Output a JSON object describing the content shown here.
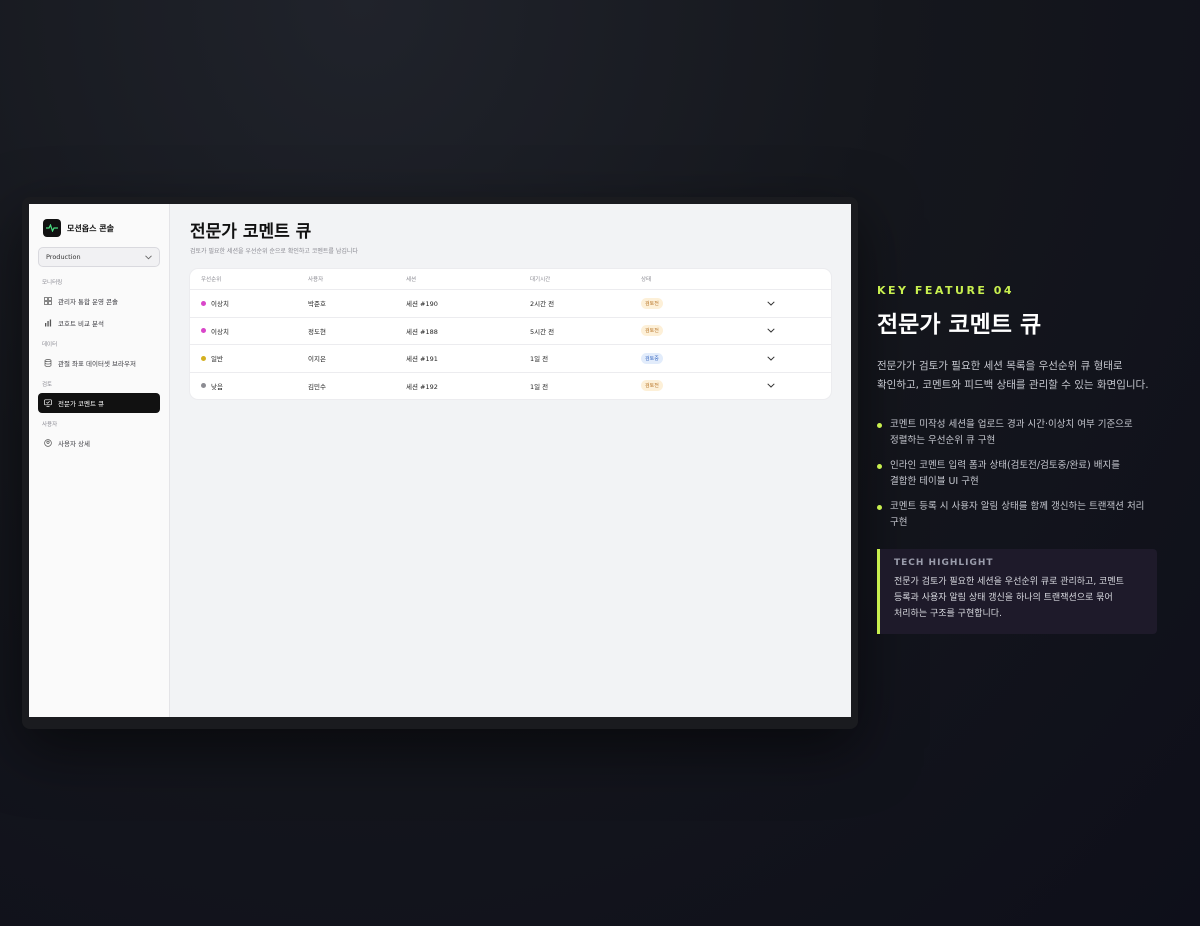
{
  "console": {
    "brand_name": "모션옵스 콘솔",
    "env_select": "Production",
    "sidebar": {
      "sections": [
        {
          "label": "모니터링",
          "items": [
            {
              "label": "관리자 통합 운영 콘솔",
              "icon": "grid-icon"
            },
            {
              "label": "코호트 비교 분석",
              "icon": "bar-chart-icon"
            }
          ]
        },
        {
          "label": "데이터",
          "items": [
            {
              "label": "관절 좌표 데이터셋 브라우저",
              "icon": "database-icon"
            }
          ]
        },
        {
          "label": "검토",
          "items": [
            {
              "label": "전문가 코멘트 큐",
              "icon": "comment-icon",
              "active": true
            }
          ]
        },
        {
          "label": "사용자",
          "items": [
            {
              "label": "사용자 상세",
              "icon": "user-circle-icon"
            }
          ]
        }
      ]
    },
    "page_title": "전문가 코멘트 큐",
    "page_subtitle": "검토가 필요한 세션을 우선순위 순으로 확인하고 코멘트를 남깁니다",
    "table": {
      "headers": [
        "우선순위",
        "사용자",
        "세션",
        "대기시간",
        "상태"
      ],
      "rows": [
        {
          "priority": "이상치",
          "dot_color": "#d946c9",
          "user": "박준호",
          "session": "세션 #190",
          "wait": "2시간 전",
          "status": "검토전",
          "status_kind": "warn"
        },
        {
          "priority": "이상치",
          "dot_color": "#d946c9",
          "user": "정도현",
          "session": "세션 #188",
          "wait": "5시간 전",
          "status": "검토전",
          "status_kind": "warn"
        },
        {
          "priority": "일반",
          "dot_color": "#d4b020",
          "user": "이지은",
          "session": "세션 #191",
          "wait": "1일 전",
          "status": "검토중",
          "status_kind": "info"
        },
        {
          "priority": "낮음",
          "dot_color": "#8c8c93",
          "user": "김민수",
          "session": "세션 #192",
          "wait": "1일 전",
          "status": "검토전",
          "status_kind": "warn"
        }
      ]
    }
  },
  "panel": {
    "kicker": "KEY FEATURE 04",
    "title": "전문가 코멘트 큐",
    "desc_lines": [
      "전문가가 검토가 필요한 세션 목록을 우선순위 큐 형태로",
      "확인하고, 코멘트와 피드백 상태를 관리할 수 있는 화면입니다."
    ],
    "bullets": [
      {
        "lines": [
          "코멘트 미작성 세션을 업로드 경과 시간·이상치 여부 기준으로",
          "정렬하는 우선순위 큐 구현"
        ]
      },
      {
        "lines": [
          "인라인 코멘트 입력 폼과 상태(검토전/검토중/완료) 배지를",
          "결합한 테이블 UI 구현"
        ]
      },
      {
        "lines": [
          "코멘트 등록 시 사용자 알림 상태를 함께 갱신하는 트랜잭션 처리",
          "구현"
        ]
      }
    ],
    "tech_title": "TECH HIGHLIGHT",
    "tech_lines": [
      "전문가 검토가 필요한 세션을 우선순위 큐로 관리하고, 코멘트",
      "등록과 사용자 알림 상태 갱신을 하나의 트랜잭션으로 묶어",
      "처리하는 구조를 구현합니다."
    ]
  },
  "colors": {
    "accent": "#c8ef4f",
    "warn_badge": "#fdf0d8",
    "info_badge": "#e2ecfb"
  }
}
